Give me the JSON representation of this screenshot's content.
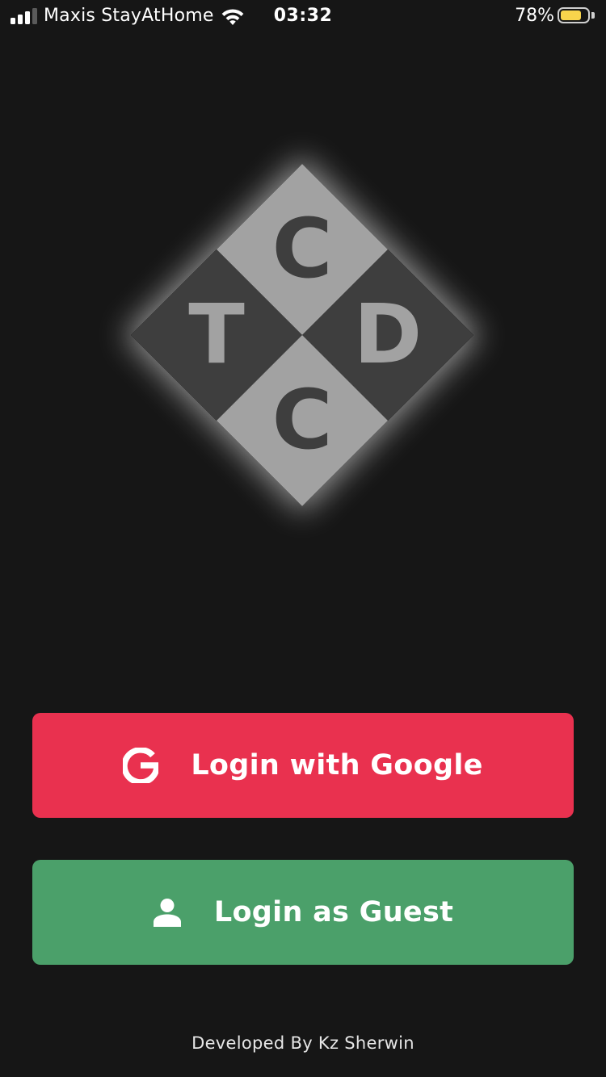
{
  "status_bar": {
    "carrier": "Maxis StayAtHome",
    "time": "03:32",
    "battery_percent_text": "78%",
    "battery_level": 0.78,
    "signal_bars_active": 3,
    "signal_bars_total": 4,
    "battery_color": "#f8d44c",
    "icons": {
      "signal": "cellular-signal-icon",
      "wifi": "wifi-icon",
      "battery": "battery-icon"
    }
  },
  "logo": {
    "letters": {
      "top": "C",
      "left": "T",
      "right": "D",
      "bottom": "C"
    },
    "colors": {
      "light_tile": "#a2a2a2",
      "dark_tile": "#3e3e3e"
    }
  },
  "buttons": {
    "google": {
      "label": "Login with Google",
      "icon": "google-g-icon",
      "color": "#e9314f"
    },
    "guest": {
      "label": "Login as Guest",
      "icon": "person-icon",
      "color": "#4ba06a"
    }
  },
  "footer": {
    "credit": "Developed By Kz Sherwin"
  },
  "colors": {
    "background": "#161616"
  }
}
